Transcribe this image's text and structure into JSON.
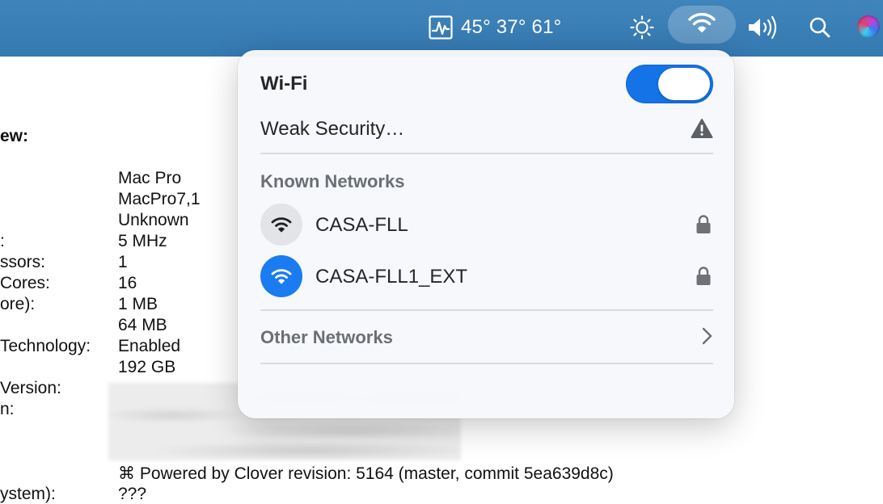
{
  "menubar": {
    "stats_temps": "45° 37° 61°",
    "icons": [
      "activity-monitor-icon",
      "brightness-icon",
      "wifi-icon",
      "volume-icon",
      "search-icon",
      "siri-icon"
    ]
  },
  "report": {
    "overview_label": "ew:",
    "rows": [
      {
        "label": "",
        "value": "Mac Pro"
      },
      {
        "label": "",
        "value": "MacPro7,1"
      },
      {
        "label": "",
        "value": "Unknown"
      },
      {
        "label": ":",
        "value": "5 MHz"
      },
      {
        "label": "ssors:",
        "value": "1"
      },
      {
        "label": "Cores:",
        "value": "16"
      },
      {
        "label": "ore):",
        "value": "1 MB"
      },
      {
        "label": "",
        "value": "64 MB"
      },
      {
        "label": " Technology:",
        "value": "Enabled"
      },
      {
        "label": "",
        "value": "192 GB"
      },
      {
        "label": " Version:",
        "value": ""
      },
      {
        "label": "n:",
        "value": ""
      }
    ],
    "powered_by": "⌘  Powered by Clover revision: 5164 (master, commit 5ea639d8c)",
    "bottom_label": "ystem):",
    "bottom_value": "???"
  },
  "wifi_panel": {
    "title": "Wi-Fi",
    "enabled": true,
    "weak_security_label": "Weak Security…",
    "known_networks_label": "Known Networks",
    "networks": [
      {
        "name": "CASA-FLL",
        "connected": false,
        "secured": true
      },
      {
        "name": "CASA-FLL1_EXT",
        "connected": true,
        "secured": true
      }
    ],
    "other_networks_label": "Other Networks"
  },
  "colors": {
    "menubar": "#3a7eb6",
    "accent": "#1473e6",
    "section_text": "#6b6f73"
  }
}
